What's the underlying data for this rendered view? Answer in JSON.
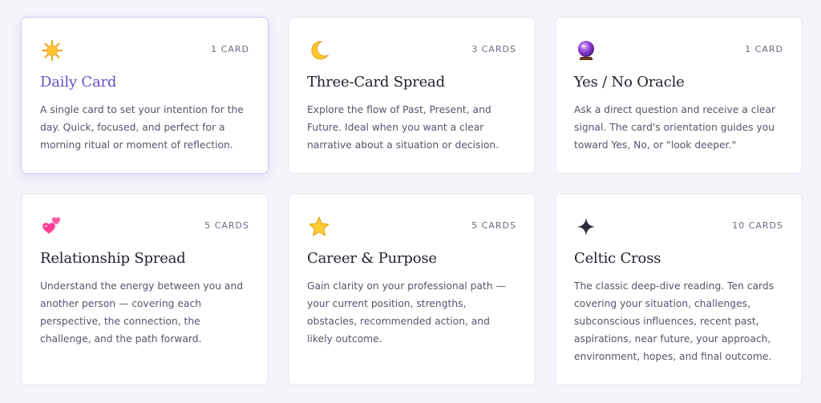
{
  "cards": [
    {
      "icon": "sun-icon",
      "count": "1 CARD",
      "title": "Daily Card",
      "description": "A single card to set your intention for the day. Quick, focused, and perfect for a morning ritual or moment of reflection.",
      "selected": true
    },
    {
      "icon": "crescent-moon-icon",
      "count": "3 CARDS",
      "title": "Three-Card Spread",
      "description": "Explore the flow of Past, Present, and Future. Ideal when you want a clear narrative about a situation or decision.",
      "selected": false
    },
    {
      "icon": "crystal-ball-icon",
      "count": "1 CARD",
      "title": "Yes / No Oracle",
      "description": "Ask a direct question and receive a clear signal. The card's orientation guides you toward Yes, No, or \"look deeper.\"",
      "selected": false
    },
    {
      "icon": "two-hearts-icon",
      "count": "5 CARDS",
      "title": "Relationship Spread",
      "description": "Understand the energy between you and another person — covering each perspective, the connection, the challenge, and the path forward.",
      "selected": false
    },
    {
      "icon": "star-icon",
      "count": "5 CARDS",
      "title": "Career & Purpose",
      "description": "Gain clarity on your professional path — your current position, strengths, obstacles, recommended action, and likely outcome.",
      "selected": false
    },
    {
      "icon": "four-point-sparkle-icon",
      "count": "10 CARDS",
      "title": "Celtic Cross",
      "description": "The classic deep-dive reading. Ten cards covering your situation, challenges, subconscious influences, recent past, aspirations, near future, your approach, environment, hopes, and final outcome.",
      "selected": false
    }
  ],
  "colors": {
    "accent": "#6a4fc8",
    "background": "#f4f4fb",
    "card": "#ffffff"
  }
}
